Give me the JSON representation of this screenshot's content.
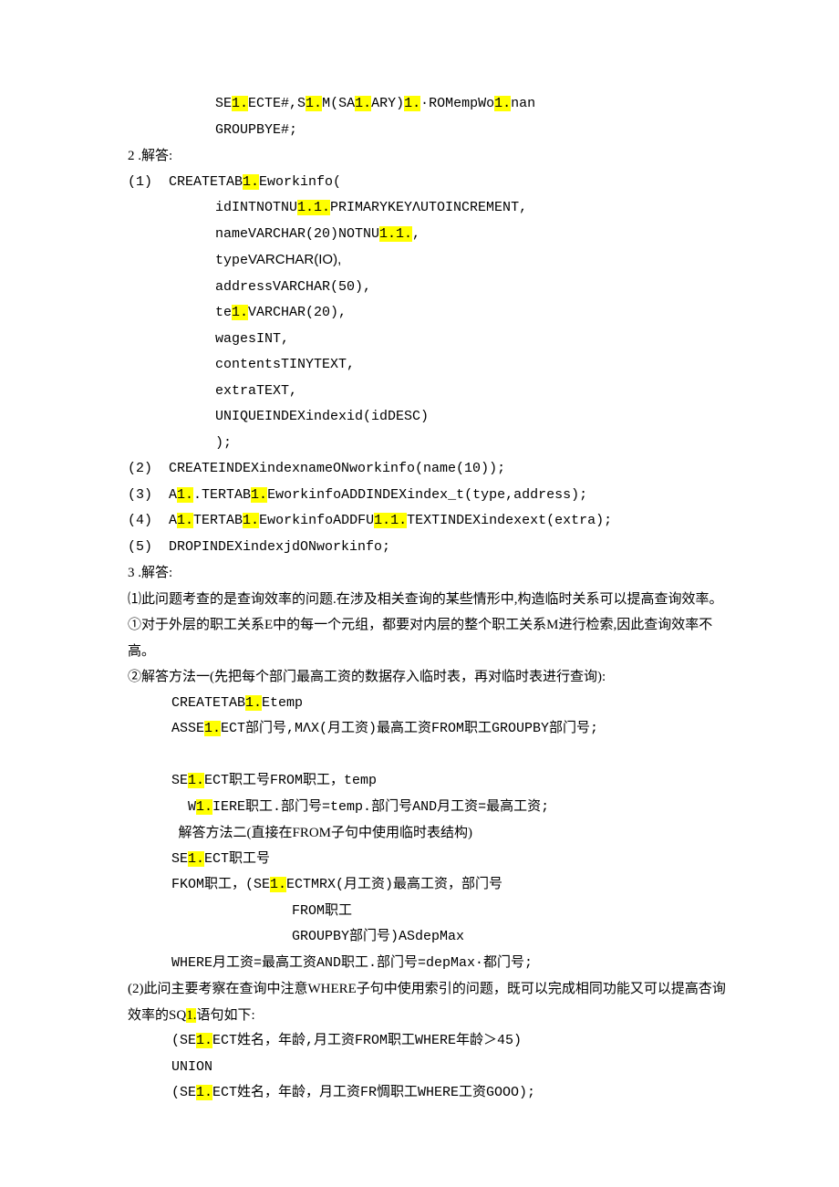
{
  "lines": [
    {
      "cls": "indent-2 mono",
      "parts": [
        {
          "t": "SE"
        },
        {
          "t": "1.",
          "hl": true
        },
        {
          "t": "ECTE#,S"
        },
        {
          "t": "1.",
          "hl": true
        },
        {
          "t": "M(SA"
        },
        {
          "t": "1.",
          "hl": true
        },
        {
          "t": "ARY)"
        },
        {
          "t": "1.",
          "hl": true
        },
        {
          "t": "∙ROMempWo"
        },
        {
          "t": "1.",
          "hl": true
        },
        {
          "t": "nan"
        }
      ]
    },
    {
      "cls": "indent-2 mono",
      "parts": [
        {
          "t": "GROUPBYE#;"
        }
      ]
    },
    {
      "cls": "num-list",
      "parts": [
        {
          "t": "2 .解答:"
        }
      ]
    },
    {
      "cls": "sub-list mono",
      "parts": [
        {
          "t": "(1)  CREATETAB"
        },
        {
          "t": "1.",
          "hl": true
        },
        {
          "t": "Eworkinfo("
        }
      ]
    },
    {
      "cls": "indent-2 mono",
      "parts": [
        {
          "t": "idINTNOTNU"
        },
        {
          "t": "1.1.",
          "hl": true
        },
        {
          "t": "PRIMARYKEYΛUTOINCREMENT,"
        }
      ]
    },
    {
      "cls": "indent-2 mono",
      "parts": [
        {
          "t": "nameVARCHAR(20)NOTNU"
        },
        {
          "t": "1.1.",
          "hl": true
        },
        {
          "t": ","
        }
      ]
    },
    {
      "cls": "indent-2",
      "parts": [
        {
          "t": "type",
          "cls": "mono"
        },
        {
          "t": "VARCHAR(IO),",
          "cls": "sans"
        }
      ]
    },
    {
      "cls": "indent-2 mono",
      "parts": [
        {
          "t": "addressVARCHAR(50),"
        }
      ]
    },
    {
      "cls": "indent-2 mono",
      "parts": [
        {
          "t": "te"
        },
        {
          "t": "1.",
          "hl": true
        },
        {
          "t": "VARCHAR(20),"
        }
      ]
    },
    {
      "cls": "indent-2 mono",
      "parts": [
        {
          "t": "wagesINT,"
        }
      ]
    },
    {
      "cls": "indent-2 mono",
      "parts": [
        {
          "t": "contentsTINYTEXT,"
        }
      ]
    },
    {
      "cls": "indent-2 mono",
      "parts": [
        {
          "t": "extraTEXT,"
        }
      ]
    },
    {
      "cls": "indent-2 mono",
      "parts": [
        {
          "t": "UNIQUEINDEXindexid(idDESC)"
        }
      ]
    },
    {
      "cls": "indent-2 mono",
      "parts": [
        {
          "t": ");"
        }
      ]
    },
    {
      "cls": "sub-list mono",
      "parts": [
        {
          "t": "(2)  CREATEINDEXindexnameONworkinfo(name(10));"
        }
      ]
    },
    {
      "cls": "sub-list mono",
      "parts": [
        {
          "t": "(3)  A"
        },
        {
          "t": "1.",
          "hl": true
        },
        {
          "t": ".TERTAB"
        },
        {
          "t": "1.",
          "hl": true
        },
        {
          "t": "EworkinfoADDINDEXindex_t(type,address);"
        }
      ]
    },
    {
      "cls": "sub-list mono",
      "parts": [
        {
          "t": "(4)  A"
        },
        {
          "t": "1.",
          "hl": true
        },
        {
          "t": "TERTAB"
        },
        {
          "t": "1.",
          "hl": true
        },
        {
          "t": "EworkinfoADDFU"
        },
        {
          "t": "1.1.",
          "hl": true
        },
        {
          "t": "TEXTINDEXindexext(extra);"
        }
      ]
    },
    {
      "cls": "sub-list mono",
      "parts": [
        {
          "t": "(5)  DROPINDEXindexjdONworkinfo;"
        }
      ]
    },
    {
      "cls": "num-list",
      "parts": [
        {
          "t": "3 .解答:"
        }
      ]
    },
    {
      "cls": "",
      "parts": [
        {
          "t": "⑴此问题考查的是查询效率的问题.在涉及相关查询的某些情形中,构造临时关系可以提高查询效率。"
        }
      ]
    },
    {
      "cls": "",
      "parts": [
        {
          "t": "①对于外层的职工关系E中的每一个元组，都要对内层的整个职工关系M进行检索,因此查询效率不高。"
        }
      ]
    },
    {
      "cls": "",
      "parts": [
        {
          "t": "②解答方法一(先把每个部门最高工资的数据存入临时表，再对临时表进行查询):"
        }
      ]
    },
    {
      "cls": "indent-1 mono",
      "parts": [
        {
          "t": "CREATETAB"
        },
        {
          "t": "1.",
          "hl": true
        },
        {
          "t": "Etemp"
        }
      ]
    },
    {
      "cls": "indent-1 mono",
      "parts": [
        {
          "t": "ASSE"
        },
        {
          "t": "1.",
          "hl": true
        },
        {
          "t": "ECT部门号,MΛX(月工资)最高工资FROM职工GROUPBY部门号;"
        }
      ]
    },
    {
      "cls": "",
      "parts": [
        {
          "t": " "
        }
      ]
    },
    {
      "cls": "indent-1 mono",
      "parts": [
        {
          "t": "SE"
        },
        {
          "t": "1.",
          "hl": true
        },
        {
          "t": "ECT职工号FROM职工，temp"
        }
      ]
    },
    {
      "cls": "indent-1 mono",
      "parts": [
        {
          "t": "  W"
        },
        {
          "t": "1.",
          "hl": true
        },
        {
          "t": "IERE职工.部门号=temp.部门号AND月工资=最高工资;"
        }
      ]
    },
    {
      "cls": "indent-1",
      "parts": [
        {
          "t": "  解答方法二(直接在FROM子句中使用临时表结构)"
        }
      ]
    },
    {
      "cls": "indent-1 mono",
      "parts": [
        {
          "t": "SE"
        },
        {
          "t": "1.",
          "hl": true
        },
        {
          "t": "ECT职工号"
        }
      ]
    },
    {
      "cls": "indent-1 mono",
      "parts": [
        {
          "t": "FKOM职工，(SE"
        },
        {
          "t": "1.",
          "hl": true
        },
        {
          "t": "ECTMRX(月工资)最高工资，部门号"
        }
      ]
    },
    {
      "cls": "indent-4 mono",
      "parts": [
        {
          "t": "FROM职工"
        }
      ]
    },
    {
      "cls": "indent-4 mono",
      "parts": [
        {
          "t": "GROUPBY部门号)ASdepMax"
        }
      ]
    },
    {
      "cls": "indent-1 mono",
      "parts": [
        {
          "t": "WHERE月工资=最高工资AND职工.部门号=depMax∙都门号;"
        }
      ]
    },
    {
      "cls": "",
      "parts": [
        {
          "t": "(2)此问主要考察在查询中注意WHERE子句中使用索引的问题，既可以完成相同功能又可以提高杏询效率的SQ"
        },
        {
          "t": "1.",
          "hl": true
        },
        {
          "t": "语句如下:"
        }
      ]
    },
    {
      "cls": "indent-1 mono",
      "parts": [
        {
          "t": "(SE"
        },
        {
          "t": "1.",
          "hl": true
        },
        {
          "t": "ECT姓名，年龄,月工资FROM职工WHERE年龄＞45)"
        }
      ]
    },
    {
      "cls": "indent-1 mono",
      "parts": [
        {
          "t": "UNION"
        }
      ]
    },
    {
      "cls": "indent-1 mono",
      "parts": [
        {
          "t": "(SE"
        },
        {
          "t": "1.",
          "hl": true
        },
        {
          "t": "ECT姓名，年龄，月工资FR惆职工WHERE工资GOOO);"
        }
      ]
    }
  ]
}
